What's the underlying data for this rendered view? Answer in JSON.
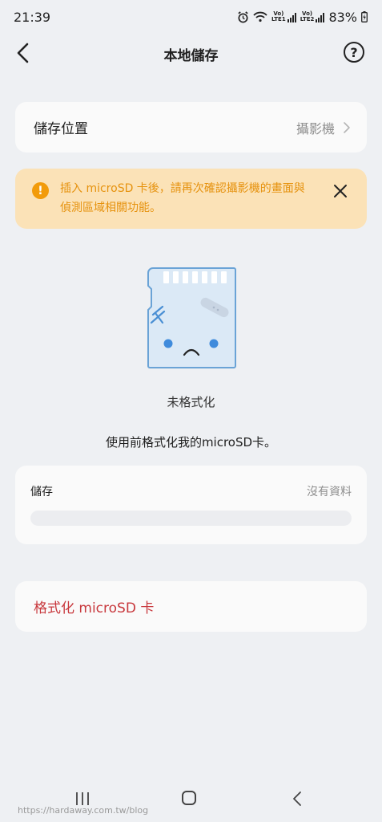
{
  "status_bar": {
    "time": "21:39",
    "sim1_label": "Vo)\nLTE1",
    "sim2_label": "Vo)\nLTE2",
    "battery": "83%"
  },
  "header": {
    "title": "本地儲存",
    "help_glyph": "?"
  },
  "storage_location": {
    "label": "儲存位置",
    "value": "攝影機"
  },
  "warning": {
    "icon_glyph": "!",
    "text": "插入 microSD 卡後，請再次確認攝影機的畫面與偵測區域相關功能。"
  },
  "sd_card": {
    "status": "未格式化",
    "hint": "使用前格式化我的microSD卡。"
  },
  "storage_info": {
    "label": "儲存",
    "value": "沒有資料",
    "usage_fraction": 0
  },
  "format_button": {
    "label": "格式化 microSD 卡"
  },
  "watermark": "https://hardaway.com.tw/blog",
  "colors": {
    "background": "#eef0f3",
    "card": "#fafafa",
    "warning_bg": "#fbe2b7",
    "warning_text": "#e6920e",
    "warning_icon": "#f29b0a",
    "danger": "#c8383d",
    "muted": "#8e8e8e"
  }
}
